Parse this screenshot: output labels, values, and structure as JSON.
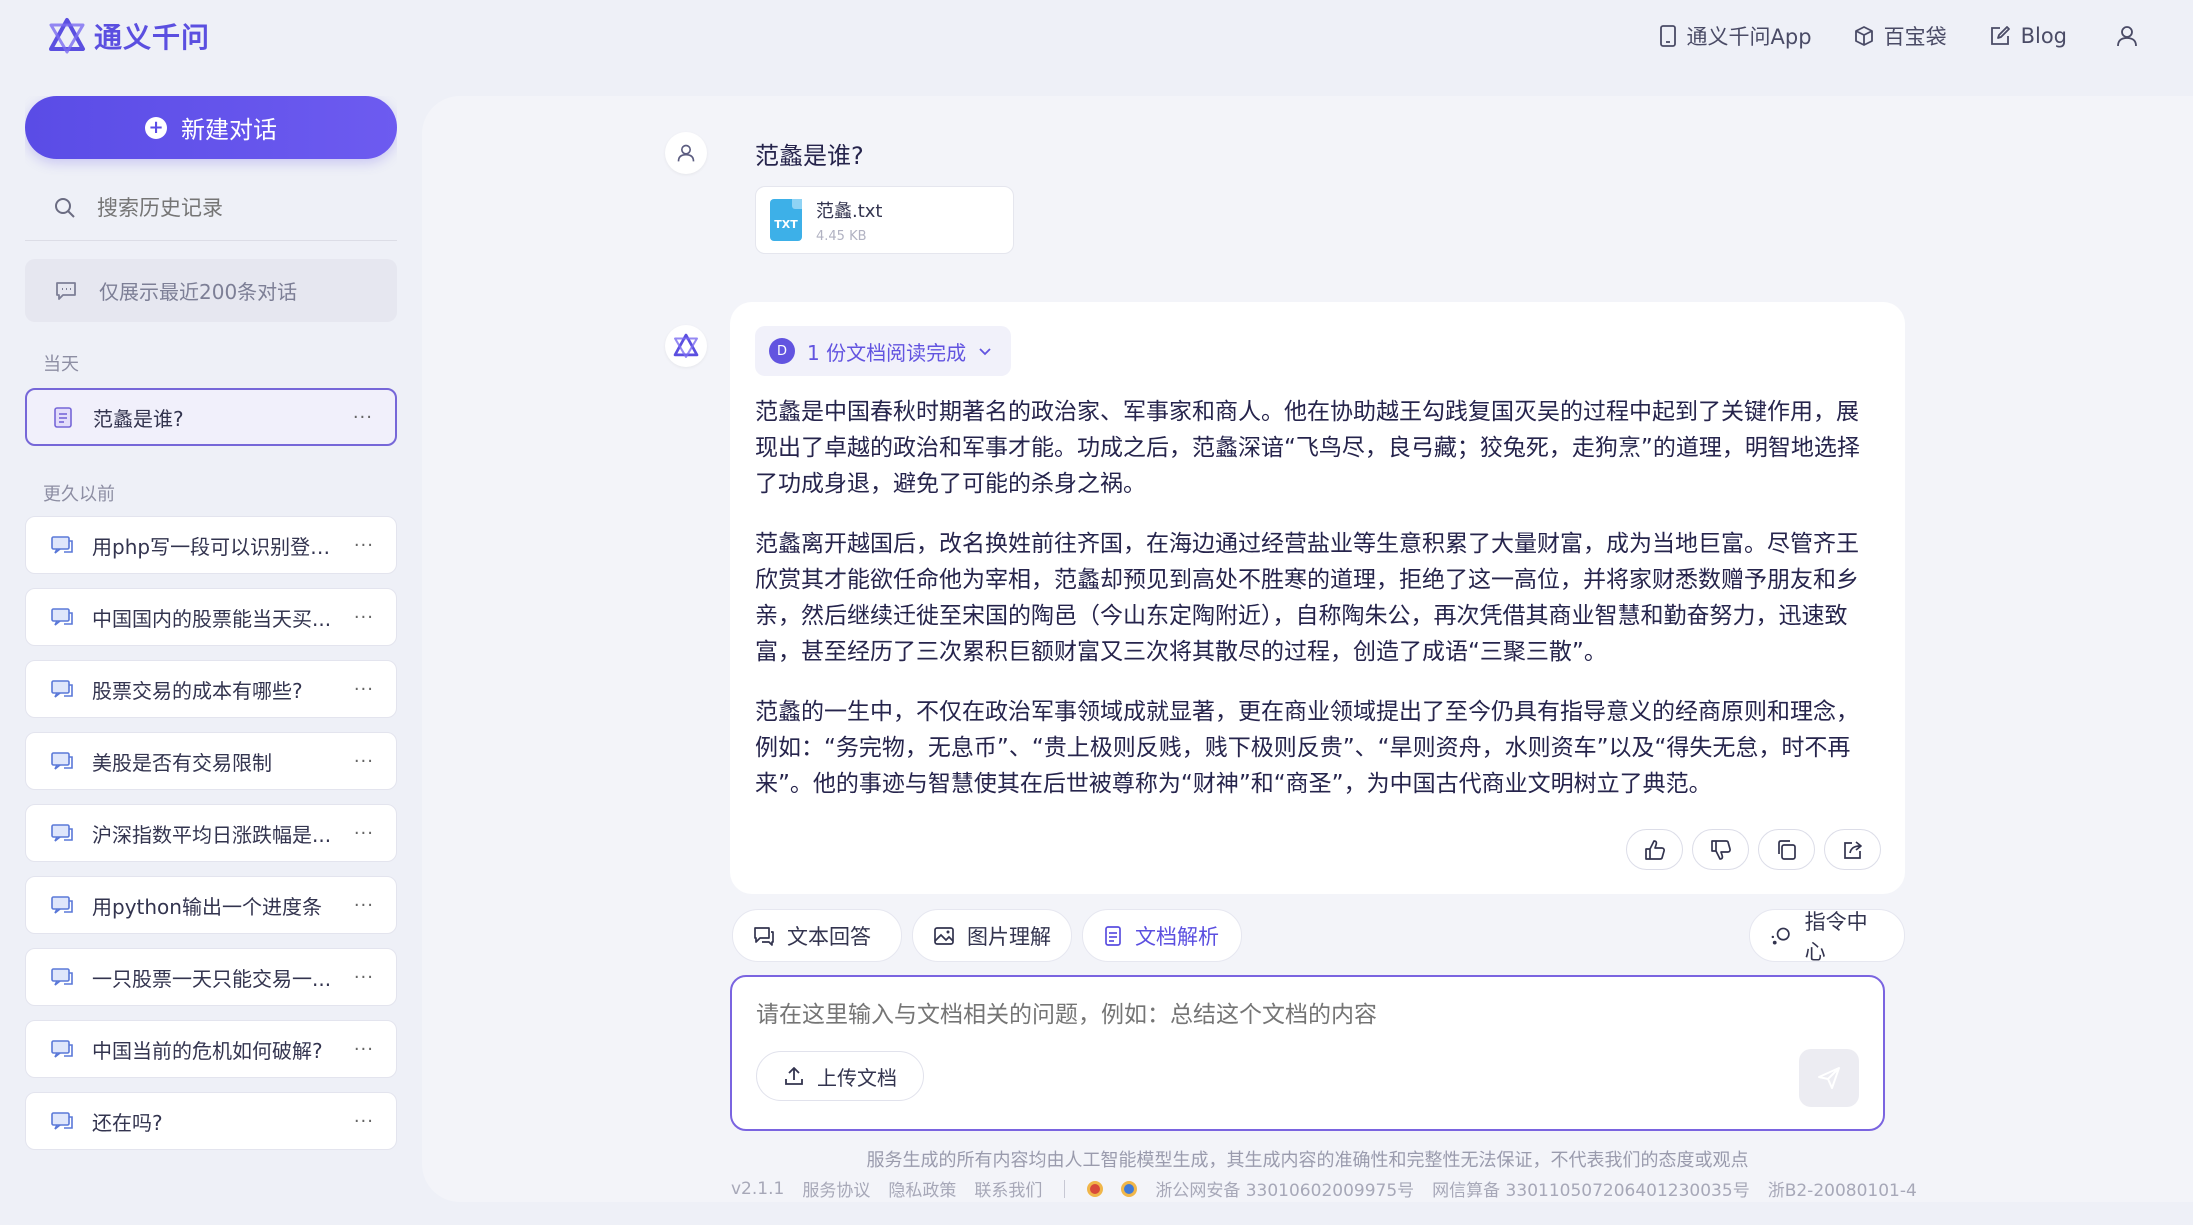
{
  "app": {
    "logo_text": "通义千问",
    "brand_color": "#5b4fe0"
  },
  "topnav": {
    "app_link": "通义千问App",
    "toolbox": "百宝袋",
    "blog": "Blog"
  },
  "sidebar": {
    "new_chat": "新建对话",
    "search_placeholder": "搜索历史记录",
    "notice": "仅展示最近200条对话",
    "today_label": "当天",
    "earlier_label": "更久以前",
    "today_items": [
      {
        "label": "范蠡是谁?",
        "icon": "document-icon"
      }
    ],
    "earlier_items": [
      {
        "label": "用php写一段可以识别登录...",
        "icon": "chat-icon"
      },
      {
        "label": "中国国内的股票能当天买...",
        "icon": "chat-icon"
      },
      {
        "label": "股票交易的成本有哪些?",
        "icon": "chat-icon"
      },
      {
        "label": "美股是否有交易限制",
        "icon": "chat-icon"
      },
      {
        "label": "沪深指数平均日涨跌幅是...",
        "icon": "chat-icon"
      },
      {
        "label": "用python输出一个进度条",
        "icon": "chat-icon"
      },
      {
        "label": "一只股票一天只能交易一...",
        "icon": "chat-icon"
      },
      {
        "label": "中国当前的危机如何破解?",
        "icon": "chat-icon"
      },
      {
        "label": "还在吗?",
        "icon": "chat-icon"
      }
    ],
    "more_label": "···"
  },
  "chat": {
    "question": "范蠡是谁?",
    "file": {
      "name": "范蠡.txt",
      "size": "4.45 KB",
      "type_label": "TXT"
    },
    "doc_status": "1 份文档阅读完成",
    "doc_badge_letter": "D",
    "answer_paragraphs": [
      "范蠡是中国春秋时期著名的政治家、军事家和商人。他在协助越王勾践复国灭吴的过程中起到了关键作用，展现出了卓越的政治和军事才能。功成之后，范蠡深谙“飞鸟尽，良弓藏；狡兔死，走狗烹”的道理，明智地选择了功成身退，避免了可能的杀身之祸。",
      "范蠡离开越国后，改名换姓前往齐国，在海边通过经营盐业等生意积累了大量财富，成为当地巨富。尽管齐王欣赏其才能欲任命他为宰相，范蠡却预见到高处不胜寒的道理，拒绝了这一高位，并将家财悉数赠予朋友和乡亲，然后继续迁徙至宋国的陶邑（今山东定陶附近），自称陶朱公，再次凭借其商业智慧和勤奋努力，迅速致富，甚至经历了三次累积巨额财富又三次将其散尽的过程，创造了成语“三聚三散”。",
      "范蠡的一生中，不仅在政治军事领域成就显著，更在商业领域提出了至今仍具有指导意义的经商原则和理念，例如：“务完物，无息币”、“贵上极则反贱，贱下极则反贵”、“旱则资舟，水则资车”以及“得失无怠，时不再来”。他的事迹与智慧使其在后世被尊称为“财神”和“商圣”，为中国古代商业文明树立了典范。"
    ]
  },
  "modes": {
    "text": "文本回答",
    "image": "图片理解",
    "doc": "文档解析",
    "command_center": "指令中心"
  },
  "input": {
    "placeholder": "请在这里输入与文档相关的问题，例如：总结这个文档的内容",
    "upload": "上传文档"
  },
  "footer": {
    "disclaimer": "服务生成的所有内容均由人工智能模型生成，其生成内容的准确性和完整性无法保证，不代表我们的态度或观点",
    "version": "v2.1.1",
    "terms": "服务协议",
    "privacy": "隐私政策",
    "contact": "联系我们",
    "police_record": "浙公网安备 33010602009975号",
    "icp_record": "网信算备 330110507206401230035号",
    "license": "浙B2-20080101-4"
  }
}
